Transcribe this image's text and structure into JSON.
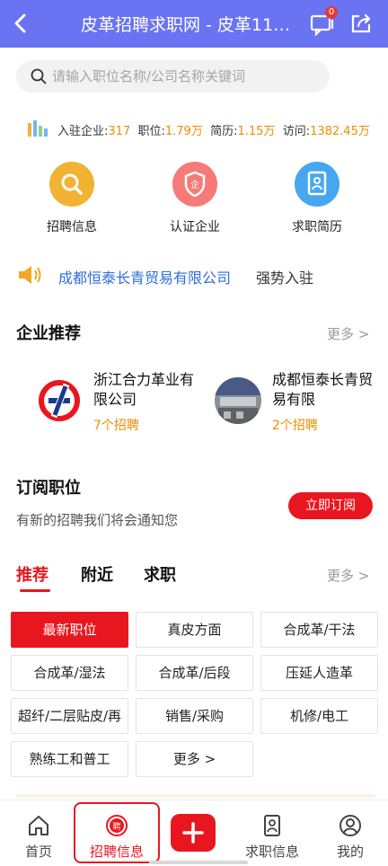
{
  "header": {
    "title": "皮革招聘求职网 - 皮革11…",
    "message_badge": "0"
  },
  "search": {
    "placeholder": "请输入职位名称/公司名称关键词"
  },
  "stats": {
    "companies_label": "入驻企业:",
    "companies_value": "317",
    "jobs_label": "职位:",
    "jobs_value": "1.79万",
    "resumes_label": "简历:",
    "resumes_value": "1.15万",
    "visits_label": "访问:",
    "visits_value": "1382.45万"
  },
  "quick_links": [
    {
      "label": "招聘信息",
      "icon": "search-icon",
      "color": "#f2b233"
    },
    {
      "label": "认证企业",
      "icon": "shield-icon",
      "color": "#f47b78"
    },
    {
      "label": "求职简历",
      "icon": "resume-icon",
      "color": "#45a7ef"
    }
  ],
  "notice": {
    "company": "成都恒泰长青贸易有限公司",
    "suffix": "强势入驻"
  },
  "enterprise": {
    "title": "企业推荐",
    "more": "更多 >",
    "companies": [
      {
        "name": "浙江合力革业有限公司",
        "jobs": "7个招聘"
      },
      {
        "name": "成都恒泰长青贸易有限",
        "jobs": "2个招聘"
      }
    ]
  },
  "subscribe": {
    "title": "订阅职位",
    "desc": "有新的招聘我们将会通知您",
    "button": "立即订阅"
  },
  "job_tabs": {
    "tabs": [
      "推荐",
      "附近",
      "求职"
    ],
    "active": "推荐",
    "more": "更多 >"
  },
  "categories": [
    "最新职位",
    "真皮方面",
    "合成革/干法",
    "合成革/湿法",
    "合成革/后段",
    "压延人造革",
    "超纤/二层贴皮/再",
    "销售/采购",
    "机修/电工",
    "熟练工和普工",
    "更多 >"
  ],
  "tabbar": {
    "items": [
      "首页",
      "招聘信息",
      "",
      "求职信息",
      "我的"
    ],
    "active": "招聘信息"
  },
  "colors": {
    "primary_red": "#e8171f",
    "header_purple": "#6a73f2",
    "accent_orange": "#f08c00",
    "link_blue": "#2d6fd8"
  }
}
